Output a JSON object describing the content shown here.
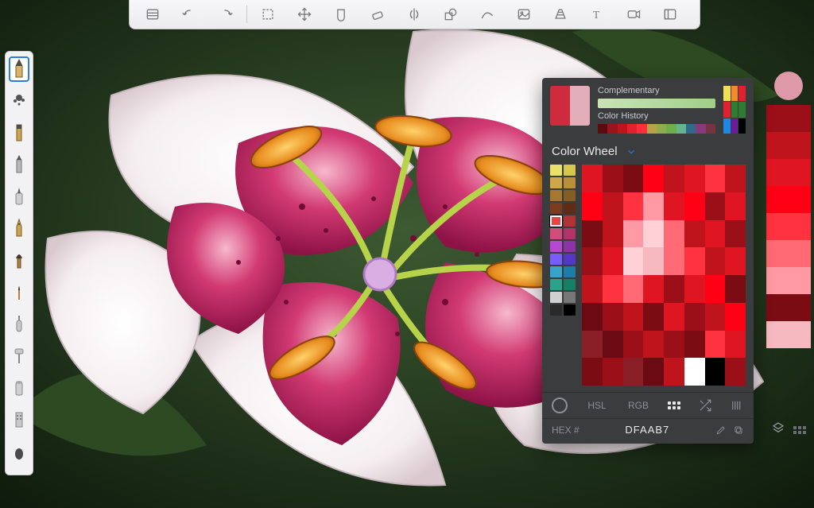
{
  "topbar": {
    "tools": [
      "library-icon",
      "undo-icon",
      "redo-icon",
      "select-icon",
      "transform-icon",
      "fill-icon",
      "erase-icon",
      "symmetry-icon",
      "shapes-icon",
      "curve-icon",
      "image-icon",
      "perspective-icon",
      "text-icon",
      "timelapse-icon",
      "ui-icon"
    ]
  },
  "leftbar": {
    "brushes": [
      "pencil",
      "splatter",
      "felt",
      "chisel",
      "marker",
      "pen",
      "paintbrush",
      "fine-brush",
      "airbrush",
      "roller",
      "smudge",
      "pattern",
      "blob"
    ],
    "selected": "pencil"
  },
  "rightstrip": {
    "dot_color": "#dd99a8",
    "bands": [
      "#9a0f18",
      "#c0141c",
      "#e01522",
      "#ff0015",
      "#ff3340",
      "#ff6a74",
      "#ff99a3",
      "#7b0c14",
      "#f7b9c0"
    ]
  },
  "colorpanel": {
    "swatch_a": "#cf2b3e",
    "swatch_b": "#e2aeb9",
    "labels": {
      "complementary": "Complementary",
      "history": "Color History",
      "wheel": "Color Wheel",
      "hex": "HEX #",
      "hsl": "HSL",
      "rgb": "RGB"
    },
    "complementary_gradient": [
      "#c9e3b6",
      "#9fd087"
    ],
    "history": [
      "#5a0b10",
      "#9a141c",
      "#c0141c",
      "#e2212d",
      "#ff2f3c",
      "#b7a24a",
      "#8fae4a",
      "#6fae4a",
      "#62b58c",
      "#2f6a8c",
      "#8a3a7a",
      "#793241"
    ],
    "mini": [
      "#f2e054",
      "#f28a2e",
      "#e22030",
      "#e22030",
      "#2e7d32",
      "#2e7d32",
      "#1e88e5",
      "#6a1b9a",
      "#000000"
    ],
    "palette_column": [
      "#e9e16a",
      "#d6c84e",
      "#cfa648",
      "#bb8f3a",
      "#a8772f",
      "#845c24",
      "#7a3c1e",
      "#5e2c16",
      "#e04848",
      "#b23333",
      "#d34d7b",
      "#b23367",
      "#b44ad4",
      "#8a34a8",
      "#7a5cff",
      "#5438c4",
      "#36a3c9",
      "#1e7da3",
      "#2aa38a",
      "#178064",
      "#d0d0d0",
      "#777777",
      "#2a2a2a",
      "#000000"
    ],
    "palette_selected_index": 8,
    "grid": [
      "#e01522",
      "#9a0f18",
      "#7b0c14",
      "#ff0015",
      "#c0141c",
      "#e01522",
      "#ff3340",
      "#c0141c",
      "#ff0015",
      "#c0141c",
      "#ff3340",
      "#ff99a3",
      "#e01522",
      "#ff0015",
      "#9a0f18",
      "#e01522",
      "#7b0c14",
      "#c0141c",
      "#ff99a3",
      "#ffd1d6",
      "#ff6a74",
      "#c0141c",
      "#e01522",
      "#9a0f18",
      "#9a0f18",
      "#e01522",
      "#ffd1d6",
      "#f7b9c0",
      "#ff6a74",
      "#ff3340",
      "#c0141c",
      "#e01522",
      "#c0141c",
      "#ff3340",
      "#ff6a74",
      "#e01522",
      "#9a0f18",
      "#e01522",
      "#ff0015",
      "#7b0c14",
      "#6b0a12",
      "#9a0f18",
      "#c0141c",
      "#7b0c14",
      "#e01522",
      "#9a0f18",
      "#c0141c",
      "#ff0015",
      "#8a1f28",
      "#6b0a12",
      "#9a0f18",
      "#c0141c",
      "#9a0f18",
      "#7b0c14",
      "#ff3340",
      "#e01522",
      "#7b0c14",
      "#9a0f18",
      "#8a1f28",
      "#6b0a12",
      "#c0141c",
      "#ffffff",
      "#000000",
      "#9a0f18"
    ],
    "mode": "grid",
    "hex": "DFAAB7"
  }
}
